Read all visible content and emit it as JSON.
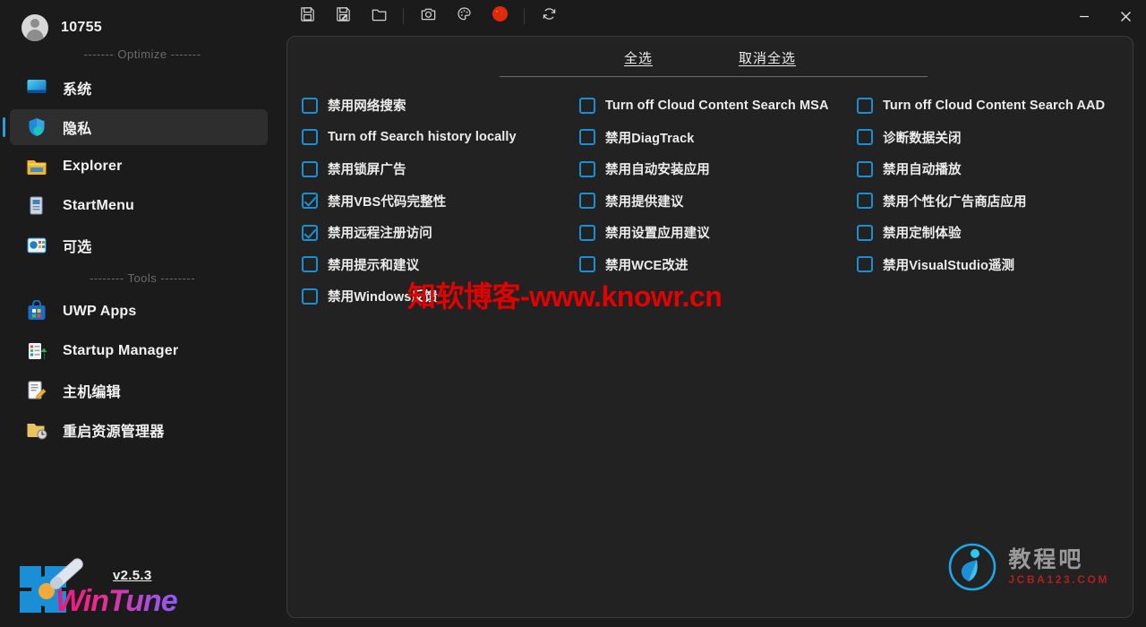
{
  "window": {
    "user_name": "10755",
    "avatar_icon": "user-avatar-icon",
    "minimize_label": "—",
    "close_label": "✕"
  },
  "toolbar": {
    "buttons": [
      {
        "name": "save-icon",
        "title": "Save"
      },
      {
        "name": "save-as-icon",
        "title": "Save As"
      },
      {
        "name": "open-folder-icon",
        "title": "Open"
      },
      {
        "name": "camera-icon",
        "title": "Screenshot"
      },
      {
        "name": "palette-icon",
        "title": "Theme"
      },
      {
        "name": "flag-china-icon",
        "title": "Language"
      },
      {
        "name": "refresh-icon",
        "title": "Refresh"
      }
    ]
  },
  "sidebar": {
    "group_optimize": "------- Optimize -------",
    "group_tools": "-------- Tools --------",
    "items_optimize": [
      {
        "label": "系统",
        "icon": "monitor-icon",
        "selected": false
      },
      {
        "label": "隐私",
        "icon": "shield-icon",
        "selected": true
      },
      {
        "label": "Explorer",
        "icon": "folder-icon",
        "selected": false
      },
      {
        "label": "StartMenu",
        "icon": "startmenu-icon",
        "selected": false
      },
      {
        "label": "可选",
        "icon": "options-icon",
        "selected": false
      }
    ],
    "items_tools": [
      {
        "label": "UWP Apps",
        "icon": "store-icon",
        "selected": false
      },
      {
        "label": "Startup Manager",
        "icon": "startup-icon",
        "selected": false
      },
      {
        "label": "主机编辑",
        "icon": "hosts-edit-icon",
        "selected": false
      },
      {
        "label": "重启资源管理器",
        "icon": "restart-explorer-icon",
        "selected": false
      }
    ],
    "version": "v2.5.3",
    "brand": "WinTune"
  },
  "panel": {
    "select_all": "全选",
    "deselect_all": "取消全选",
    "columns": [
      {
        "items": [
          {
            "label": "禁用网络搜索",
            "checked": false
          },
          {
            "label": "Turn off Search history locally",
            "checked": false
          },
          {
            "label": "禁用锁屏广告",
            "checked": false
          },
          {
            "label": "禁用VBS代码完整性",
            "checked": true
          },
          {
            "label": "禁用远程注册访问",
            "checked": true
          },
          {
            "label": "禁用提示和建议",
            "checked": false
          },
          {
            "label": "禁用Windows反馈",
            "checked": false
          }
        ]
      },
      {
        "items": [
          {
            "label": "Turn off Cloud Content Search MSA",
            "checked": false
          },
          {
            "label": "禁用DiagTrack",
            "checked": false
          },
          {
            "label": "禁用自动安装应用",
            "checked": false
          },
          {
            "label": "禁用提供建议",
            "checked": false
          },
          {
            "label": "禁用设置应用建议",
            "checked": false
          },
          {
            "label": "禁用WCE改进",
            "checked": false
          }
        ]
      },
      {
        "items": [
          {
            "label": "Turn off Cloud Content Search AAD",
            "checked": false
          },
          {
            "label": "诊断数据关闭",
            "checked": false
          },
          {
            "label": "禁用自动播放",
            "checked": false
          },
          {
            "label": "禁用个性化广告商店应用",
            "checked": false
          },
          {
            "label": "禁用定制体验",
            "checked": false
          },
          {
            "label": "禁用VisualStudio遥测",
            "checked": false
          }
        ]
      }
    ]
  },
  "watermarks": {
    "center": "知软博客-www.knowr.cn",
    "corner_cn": "教程吧",
    "corner_en": "JCBA123.COM"
  },
  "colors": {
    "accent": "#1b8fd6",
    "sidebar_bg": "#1b1b1b",
    "panel_bg": "#222222",
    "panel_border": "#3a3a3a",
    "watermark_red": "#e00000",
    "selected_bg": "#2e2e2e"
  }
}
